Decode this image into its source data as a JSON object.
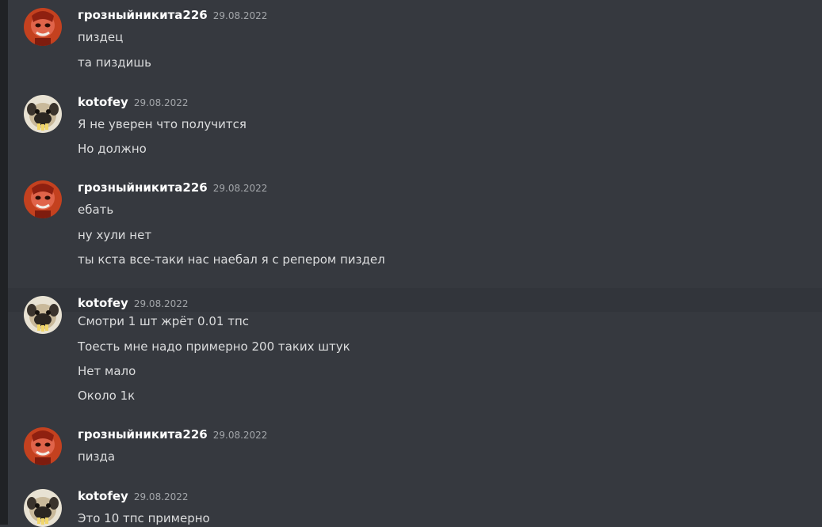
{
  "colors": {
    "background": "#36393f",
    "hover_background": "#32353b",
    "username": "#ffffff",
    "message_text": "#dcddde",
    "timestamp": "#a3a6aa"
  },
  "messages": [
    {
      "author": "грозныйникита226",
      "avatar": "red-character-avatar",
      "date": "29.08.2022",
      "lines": [
        "пиздец",
        "та пиздишь"
      ]
    },
    {
      "author": "kotofey",
      "avatar": "pug-avatar",
      "date": "29.08.2022",
      "lines": [
        "Я не уверен что получится",
        "Но должно"
      ]
    },
    {
      "author": "грозныйникита226",
      "avatar": "red-character-avatar",
      "date": "29.08.2022",
      "lines": [
        "ебать",
        "ну хули нет",
        "ты кста все-таки нас наебал я с репером пиздел"
      ]
    },
    {
      "author": "kotofey",
      "avatar": "pug-avatar",
      "date": "29.08.2022",
      "lines": [
        "Смотри 1 шт жрёт 0.01 тпс",
        "Тоесть мне надо примерно 200 таких штук",
        "Нет мало",
        "Около 1к"
      ]
    },
    {
      "author": "грозныйникита226",
      "avatar": "red-character-avatar",
      "date": "29.08.2022",
      "lines": [
        "пизда"
      ]
    },
    {
      "author": "kotofey",
      "avatar": "pug-avatar",
      "date": "29.08.2022",
      "lines": [
        "Это 10 тпс примерно"
      ]
    }
  ]
}
